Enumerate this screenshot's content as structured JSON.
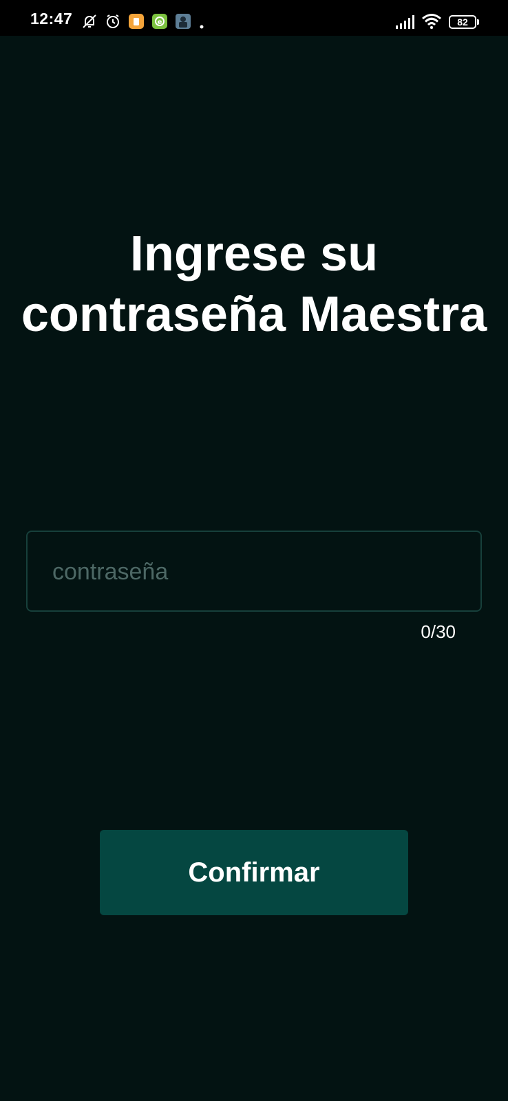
{
  "status_bar": {
    "time": "12:47",
    "battery_level": "82",
    "left_icons": [
      "notifications-off-icon",
      "alarm-icon",
      "orange-app-icon",
      "green-app-icon",
      "game-app-icon",
      "dot-icon"
    ],
    "right_icons": [
      "cellular-signal-icon",
      "wifi-icon",
      "battery-icon"
    ]
  },
  "title": {
    "line1": "Ingrese su",
    "line2": "contraseña Maestra"
  },
  "password": {
    "value": "",
    "placeholder": "contraseña",
    "counter": "0/30"
  },
  "confirm_label": "Confirmar",
  "colors": {
    "background": "#031312",
    "accent": "#054741",
    "field_border": "#17403b",
    "placeholder": "#4d6865"
  }
}
